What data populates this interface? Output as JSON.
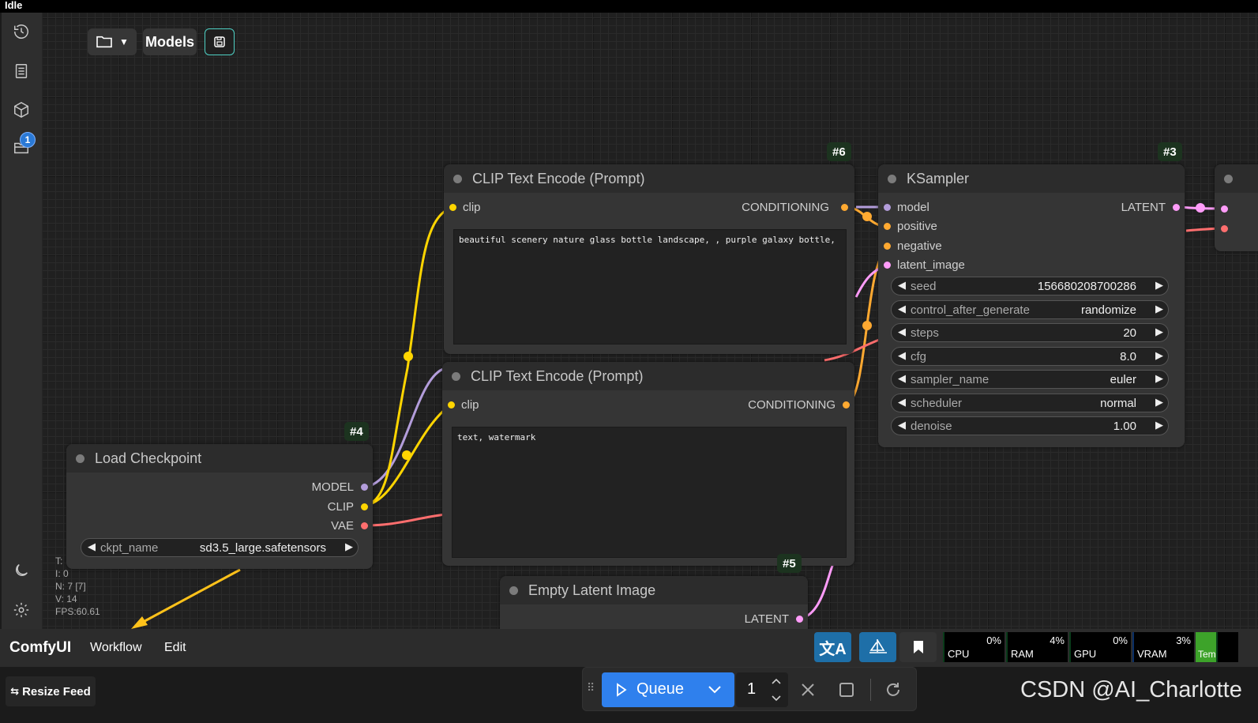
{
  "status": "Idle",
  "toolbar": {
    "models_label": "Models"
  },
  "sidebar": {
    "items": [
      {
        "icon": "history-icon"
      },
      {
        "icon": "queue-list-icon"
      },
      {
        "icon": "model-library-icon"
      },
      {
        "icon": "workflows-icon",
        "badge": "1"
      }
    ],
    "bottom_items": [
      {
        "icon": "theme-toggle-icon"
      },
      {
        "icon": "settings-icon"
      }
    ]
  },
  "nodes": {
    "clip_pos": {
      "id": "#6",
      "title": "CLIP Text Encode (Prompt)",
      "input": "clip",
      "output": "CONDITIONING",
      "text": "beautiful scenery nature glass bottle landscape, , purple galaxy bottle,"
    },
    "clip_neg": {
      "title": "CLIP Text Encode (Prompt)",
      "input": "clip",
      "output": "CONDITIONING",
      "text": "text, watermark"
    },
    "ksampler": {
      "id": "#3",
      "title": "KSampler",
      "inputs": [
        "model",
        "positive",
        "negative",
        "latent_image"
      ],
      "output": "LATENT",
      "widgets": [
        {
          "name": "seed",
          "value": "156680208700286"
        },
        {
          "name": "control_after_generate",
          "value": "randomize"
        },
        {
          "name": "steps",
          "value": "20"
        },
        {
          "name": "cfg",
          "value": "8.0"
        },
        {
          "name": "sampler_name",
          "value": "euler"
        },
        {
          "name": "scheduler",
          "value": "normal"
        },
        {
          "name": "denoise",
          "value": "1.00"
        }
      ]
    },
    "checkpoint": {
      "id": "#4",
      "title": "Load Checkpoint",
      "outputs": [
        "MODEL",
        "CLIP",
        "VAE"
      ],
      "widget": {
        "name": "ckpt_name",
        "value": "sd3.5_large.safetensors"
      }
    },
    "latent": {
      "id": "#5",
      "title": "Empty Latent Image",
      "output": "LATENT"
    }
  },
  "canvas_stats": [
    "T:",
    "I: 0",
    "N: 7 [7]",
    "V: 14",
    "FPS:60.61"
  ],
  "menu": {
    "brand": "ComfyUI",
    "items": [
      "Workflow",
      "Edit"
    ]
  },
  "monitors": [
    {
      "label": "CPU",
      "value": "0%"
    },
    {
      "label": "RAM",
      "value": "4%"
    },
    {
      "label": "GPU",
      "value": "0%"
    },
    {
      "label": "VRAM",
      "value": "3%"
    },
    {
      "label": "Temp",
      "value": ""
    }
  ],
  "queue": {
    "label": "Queue",
    "count": "1"
  },
  "resize_feed": "Resize Feed",
  "watermark": "CSDN @AI_Charlotte",
  "colors": {
    "clip": "#ffd500",
    "model": "#b39ddb",
    "vae": "#ff6e6e",
    "conditioning": "#ffa931",
    "latent": "#ff9cf9",
    "accent": "#2f80ed"
  }
}
